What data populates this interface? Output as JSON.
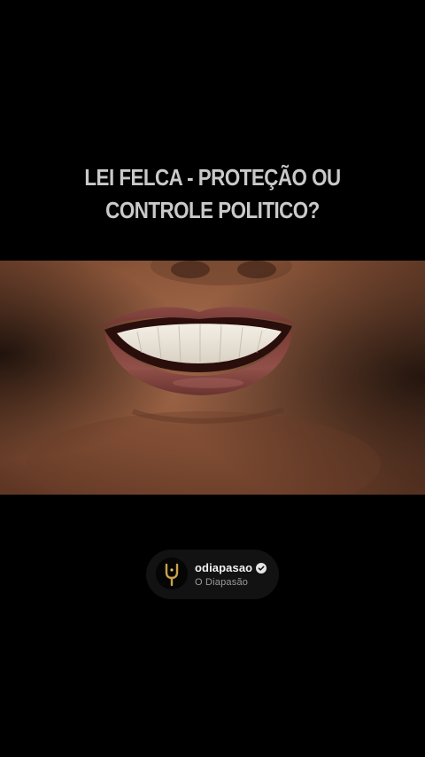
{
  "post": {
    "headline_line1": "LEI FELCA - PROTEÇÃO OU",
    "headline_line2": "CONTROLE POLITICO?",
    "image_subject": "smiling-mouth-photo"
  },
  "profile": {
    "username": "odiapasao",
    "display_name": "O Diapasão",
    "verified": true,
    "avatar_icon": "tuning-fork-icon",
    "verified_icon": "verified-badge-icon"
  },
  "colors": {
    "background": "#000000",
    "headline_text": "#c9c9c9",
    "chip_background": "#121212",
    "username_text": "#f2f2f2",
    "display_name_text": "#9a9a9a",
    "avatar_gold": "#c9a24a"
  }
}
